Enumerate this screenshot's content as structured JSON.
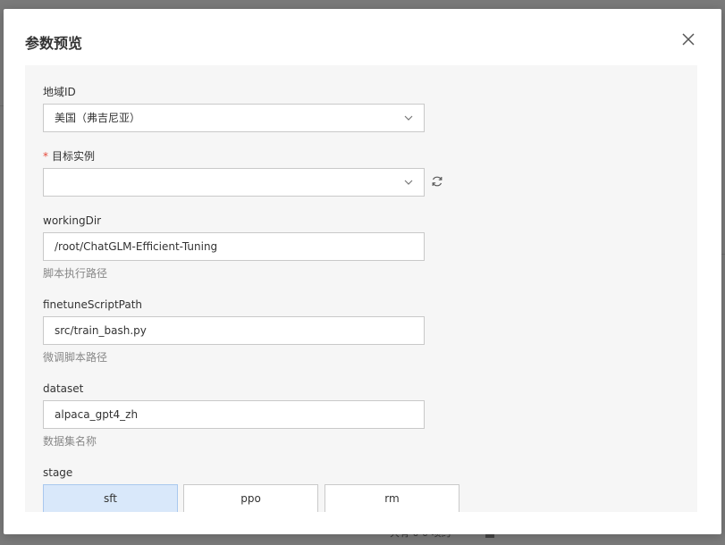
{
  "modal": {
    "title": "参数预览"
  },
  "fields": {
    "region": {
      "label": "地域ID",
      "value": "美国（弗吉尼亚）"
    },
    "target_instance": {
      "label": "目标实例",
      "required": "*",
      "value": ""
    },
    "working_dir": {
      "label": "workingDir",
      "value": "/root/ChatGLM-Efficient-Tuning",
      "hint": "脚本执行路径"
    },
    "finetune_script_path": {
      "label": "finetuneScriptPath",
      "value": "src/train_bash.py",
      "hint": "微调脚本路径"
    },
    "dataset": {
      "label": "dataset",
      "value": "alpaca_gpt4_zh",
      "hint": "数据集名称"
    },
    "stage": {
      "label": "stage",
      "options": [
        "sft",
        "ppo",
        "rm"
      ],
      "selected": "sft"
    }
  },
  "colors": {
    "selected_option_bg": "#d9e8fa",
    "required_star": "#e5493a",
    "body_bg": "#f6f6f6"
  },
  "icons": {
    "close": "close-icon",
    "chevron": "chevron-down-icon",
    "refresh": "refresh-icon"
  }
}
